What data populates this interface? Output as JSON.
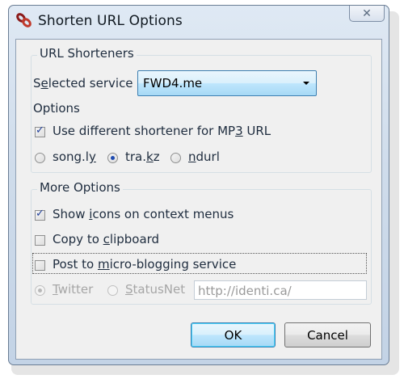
{
  "window": {
    "title": "Shorten URL Options",
    "close_symbol": "✕"
  },
  "url_shorteners": {
    "label": "URL Shorteners",
    "selected_service_label_pre": "S",
    "selected_service_label_u": "e",
    "selected_service_label_post": "lected service",
    "selected_service_value": "FWD4.me",
    "options_label": "Options",
    "use_different_pre": "Use different shortener for MP",
    "use_different_u": "3",
    "use_different_post": " URL",
    "use_different_checked": true,
    "radios": [
      {
        "pre": "song.l",
        "u": "y",
        "post": "",
        "selected": false
      },
      {
        "pre": "tra.",
        "u": "k",
        "post": "z",
        "selected": true
      },
      {
        "pre": "",
        "u": "n",
        "post": "durl",
        "selected": false
      }
    ]
  },
  "more_options": {
    "label": "More Options",
    "show_icons_pre": "Show ",
    "show_icons_u": "i",
    "show_icons_post": "cons on context menus",
    "show_icons_checked": true,
    "copy_pre": "Copy to ",
    "copy_u": "c",
    "copy_post": "lipboard",
    "copy_checked": false,
    "post_pre": "Post to ",
    "post_u": "m",
    "post_post": "icro-blogging service",
    "post_checked": false,
    "twitter_u": "T",
    "twitter_post": "witter",
    "statusnet_u": "S",
    "statusnet_post": "tatusNet",
    "url_value": "http://identi.ca/"
  },
  "buttons": {
    "ok": "OK",
    "cancel": "Cancel"
  }
}
